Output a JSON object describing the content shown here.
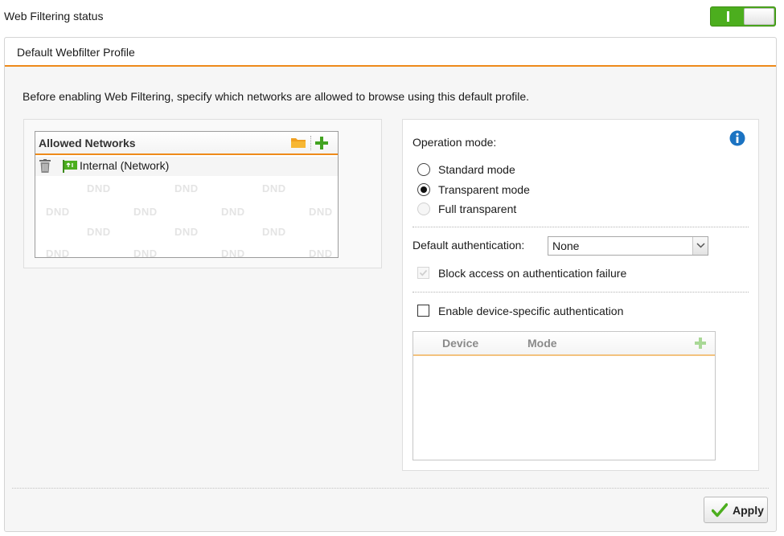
{
  "status": {
    "label": "Web Filtering status",
    "enabled": true
  },
  "panel": {
    "tab_title": "Default Webfilter Profile",
    "intro": "Before enabling Web Filtering, specify which networks are allowed to browse using this default profile."
  },
  "networks": {
    "title": "Allowed Networks",
    "items": [
      {
        "label": "Internal (Network)"
      }
    ],
    "dnd_text": "DND"
  },
  "operation": {
    "label": "Operation mode:",
    "options": [
      {
        "label": "Standard mode",
        "checked": false,
        "disabled": false
      },
      {
        "label": "Transparent mode",
        "checked": true,
        "disabled": false
      },
      {
        "label": "Full transparent",
        "checked": false,
        "disabled": true
      }
    ]
  },
  "auth": {
    "label": "Default authentication:",
    "selected": "None",
    "block_label": "Block access on authentication failure",
    "block_checked": true,
    "block_disabled": true
  },
  "device_auth": {
    "label": "Enable device-specific authentication",
    "checked": false,
    "columns": [
      "Device",
      "Mode"
    ]
  },
  "footer": {
    "apply_label": "Apply"
  },
  "colors": {
    "accent": "#ee8a1a",
    "toggle_green": "#4cae1e",
    "info_blue": "#1b73c2"
  }
}
